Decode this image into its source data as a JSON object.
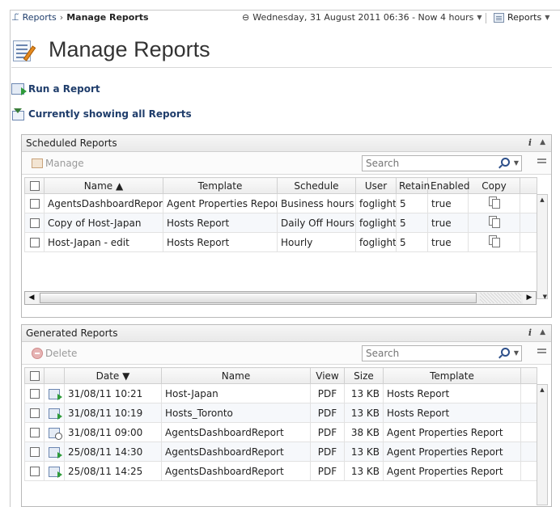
{
  "breadcrumb": {
    "root": "Reports",
    "current": "Manage Reports"
  },
  "time_range": "Wednesday, 31 August 2011 06:36 - Now 4 hours",
  "reports_menu": "Reports",
  "page_title": "Manage Reports",
  "actions": {
    "run_report": "Run a Report",
    "filter_status": "Currently showing all Reports"
  },
  "scheduled": {
    "title": "Scheduled Reports",
    "info": "i",
    "manage_label": "Manage",
    "search_placeholder": "Search",
    "columns": [
      "Name ▲",
      "Template",
      "Schedule",
      "User",
      "Retain",
      "Enabled",
      "Copy"
    ],
    "rows": [
      {
        "name": "AgentsDashboardReport",
        "template": "Agent Properties Report",
        "schedule": "Business hours",
        "user": "foglight",
        "retain": "5",
        "enabled": "true"
      },
      {
        "name": "Copy of Host-Japan",
        "template": "Hosts Report",
        "schedule": "Daily Off Hours",
        "user": "foglight",
        "retain": "5",
        "enabled": "true"
      },
      {
        "name": "Host-Japan - edit",
        "template": "Hosts Report",
        "schedule": "Hourly",
        "user": "foglight",
        "retain": "5",
        "enabled": "true"
      }
    ]
  },
  "generated": {
    "title": "Generated Reports",
    "info": "i",
    "delete_label": "Delete",
    "search_placeholder": "Search",
    "columns": [
      "Date ▼",
      "Name",
      "View",
      "Size",
      "Template"
    ],
    "rows": [
      {
        "icon": "report-run-icon",
        "date": "31/08/11 10:21",
        "name": "Host-Japan",
        "view": "PDF",
        "size": "13 KB",
        "template": "Hosts Report"
      },
      {
        "icon": "report-run-icon",
        "date": "31/08/11 10:19",
        "name": "Hosts_Toronto",
        "view": "PDF",
        "size": "13 KB",
        "template": "Hosts Report"
      },
      {
        "icon": "report-scheduled-icon",
        "date": "31/08/11 09:00",
        "name": "AgentsDashboardReport",
        "view": "PDF",
        "size": "38 KB",
        "template": "Agent Properties Report"
      },
      {
        "icon": "report-run-icon",
        "date": "25/08/11 14:30",
        "name": "AgentsDashboardReport",
        "view": "PDF",
        "size": "13 KB",
        "template": "Agent Properties Report"
      },
      {
        "icon": "report-run-icon",
        "date": "25/08/11 14:25",
        "name": "AgentsDashboardReport",
        "view": "PDF",
        "size": "13 KB",
        "template": "Agent Properties Report"
      }
    ]
  }
}
